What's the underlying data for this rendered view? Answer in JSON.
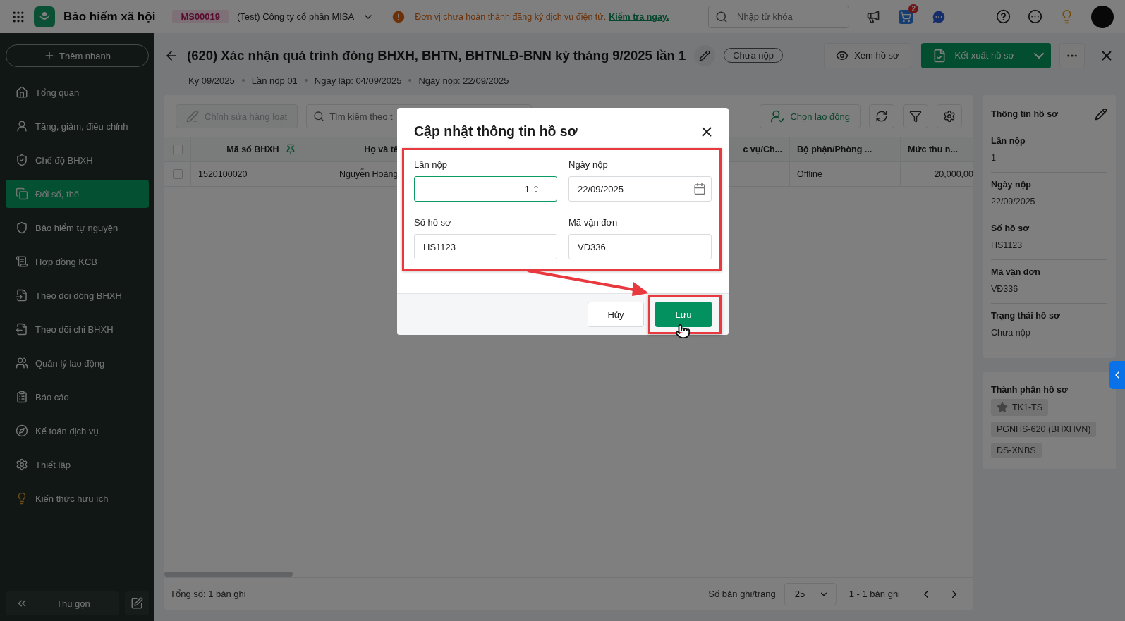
{
  "app": {
    "title": "Bảo hiểm xã hội",
    "company_code": "MS00019",
    "company_name": "(Test) Công ty cổ phần MISA",
    "notice": "Đơn vị chưa hoàn thành đăng ký dịch vụ điện tử.",
    "notice_link": "Kiểm tra ngay.",
    "search_placeholder": "Nhập từ khóa",
    "cart_badge": "2"
  },
  "sidebar": {
    "quick_add": "Thêm nhanh",
    "items": [
      {
        "label": "Tổng quan",
        "selected": false
      },
      {
        "label": "Tăng, giảm, điều chỉnh",
        "selected": false
      },
      {
        "label": "Chế độ BHXH",
        "selected": false
      },
      {
        "label": "Đổi sổ, thẻ",
        "selected": true
      },
      {
        "label": "Bảo hiểm tự nguyện",
        "selected": false
      },
      {
        "label": "Hợp đồng KCB",
        "selected": false
      },
      {
        "label": "Theo dõi đóng BHXH",
        "selected": false
      },
      {
        "label": "Theo dõi chi BHXH",
        "selected": false
      },
      {
        "label": "Quản lý lao động",
        "selected": false
      },
      {
        "label": "Báo cáo",
        "selected": false
      },
      {
        "label": "Kế toán dịch vụ",
        "selected": false
      },
      {
        "label": "Thiết lập",
        "selected": false
      },
      {
        "label": "Kiến thức hữu ích",
        "selected": false
      }
    ],
    "collapse": "Thu gọn"
  },
  "page": {
    "title": "(620) Xác nhận quá trình đóng BHXH, BHTN, BHTNLĐ-BNN kỳ tháng 9/2025 lần 1",
    "status": "Chưa nộp",
    "meta": [
      "Kỳ 09/2025",
      "Lần nộp 01",
      "Ngày lập: 04/09/2025",
      "Ngày nộp: 22/09/2025"
    ],
    "view_button": "Xem hồ sơ",
    "export_button": "Kết xuất hồ sơ"
  },
  "toolbar": {
    "bulk_edit": {
      "label": "Chỉnh sửa hàng loạt",
      "disabled": true
    },
    "search_placeholder": "Tìm kiếm theo t",
    "choose_button": "Chọn lao động"
  },
  "table": {
    "all_checked": false,
    "columns": [
      {
        "label": "Mã số BHXH",
        "pinned": true
      },
      {
        "label": "Họ và tê",
        "pinned": false
      },
      {
        "label": "c vụ/Ch...",
        "pinned": false
      },
      {
        "label": "Bộ phận/Phòng ...",
        "pinned": false
      },
      {
        "label": "Mức thu n...",
        "pinned": false
      }
    ],
    "rows": [
      {
        "checked": false,
        "cells": [
          "1520100020",
          "Nguyễn Hoàng",
          null,
          "Offline",
          "20,000,00"
        ]
      }
    ]
  },
  "footer": {
    "total": "Tổng số: 1 bản ghi",
    "page_size_label": "Số bản ghi/trang",
    "page_size": "25",
    "range": "1 - 1 bản ghi"
  },
  "info_panel": {
    "title": "Thông tin hồ sơ",
    "fields": [
      {
        "label": "Lần nộp",
        "value": "1"
      },
      {
        "label": "Ngày nộp",
        "value": "22/09/2025"
      },
      {
        "label": "Số hồ sơ",
        "value": "HS1123"
      },
      {
        "label": "Mã vận đơn",
        "value": "VĐ336"
      },
      {
        "label": "Trạng thái hồ sơ",
        "value": "Chưa nộp"
      }
    ]
  },
  "components": {
    "title": "Thành phần hồ sơ",
    "items": [
      {
        "label": "TK1-TS",
        "starred": true
      },
      {
        "label": "PGNHS-620 (BHXHVN)",
        "starred": false
      },
      {
        "label": "DS-XNBS",
        "starred": false
      }
    ]
  },
  "dialog": {
    "title": "Cập nhật thông tin hồ sơ",
    "fields": [
      {
        "kind": "number",
        "label": "Lần nộp",
        "value": "1",
        "focused": true
      },
      {
        "kind": "date",
        "label": "Ngày nộp",
        "value": "22/09/2025",
        "focused": false
      },
      {
        "kind": "text",
        "label": "Số hồ sơ",
        "value": "HS1123",
        "focused": false
      },
      {
        "kind": "text",
        "label": "Mã vận đơn",
        "value": "VĐ336",
        "focused": false
      }
    ],
    "cancel": "Hủy",
    "save": "Lưu"
  }
}
